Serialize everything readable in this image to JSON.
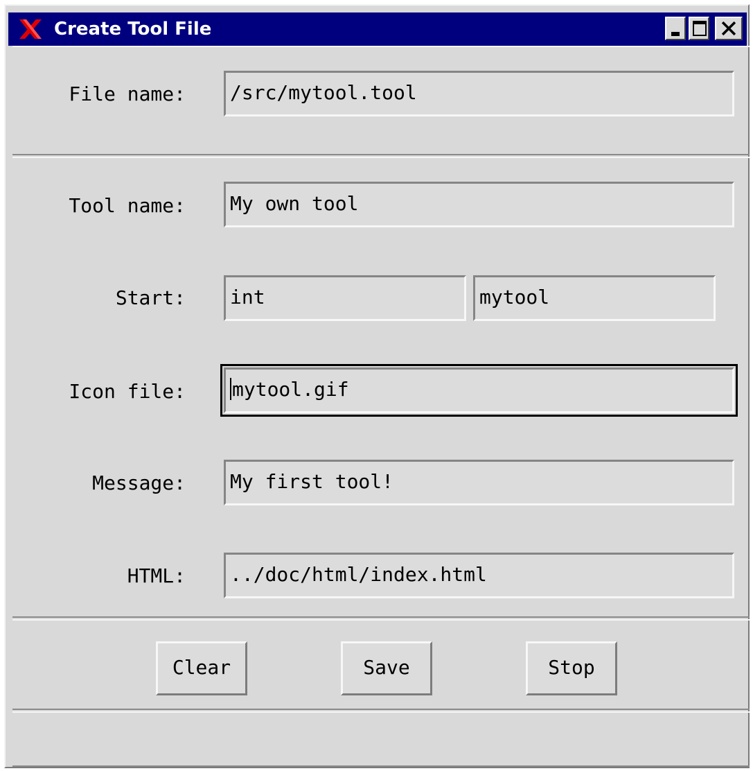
{
  "window": {
    "title": "Create Tool File",
    "controls": {
      "minimize": "minimize-icon",
      "maximize": "maximize-icon",
      "close": "close-icon"
    }
  },
  "form": {
    "file_name_label": "File name:",
    "file_name_value": "/src/mytool.tool",
    "tool_name_label": "Tool name:",
    "tool_name_value": "My own tool",
    "start_label": "Start:",
    "start_value_1": "int",
    "start_value_2": "mytool",
    "icon_file_label": "Icon file:",
    "icon_file_value": "mytool.gif",
    "message_label": "Message:",
    "message_value": "My first tool!",
    "html_label": "HTML:",
    "html_value": "../doc/html/index.html"
  },
  "buttons": {
    "clear": "Clear",
    "save": "Save",
    "stop": "Stop"
  },
  "colors": {
    "titlebar": "#00007f",
    "background": "#d9d9d9",
    "app_icon": "#e00000"
  }
}
